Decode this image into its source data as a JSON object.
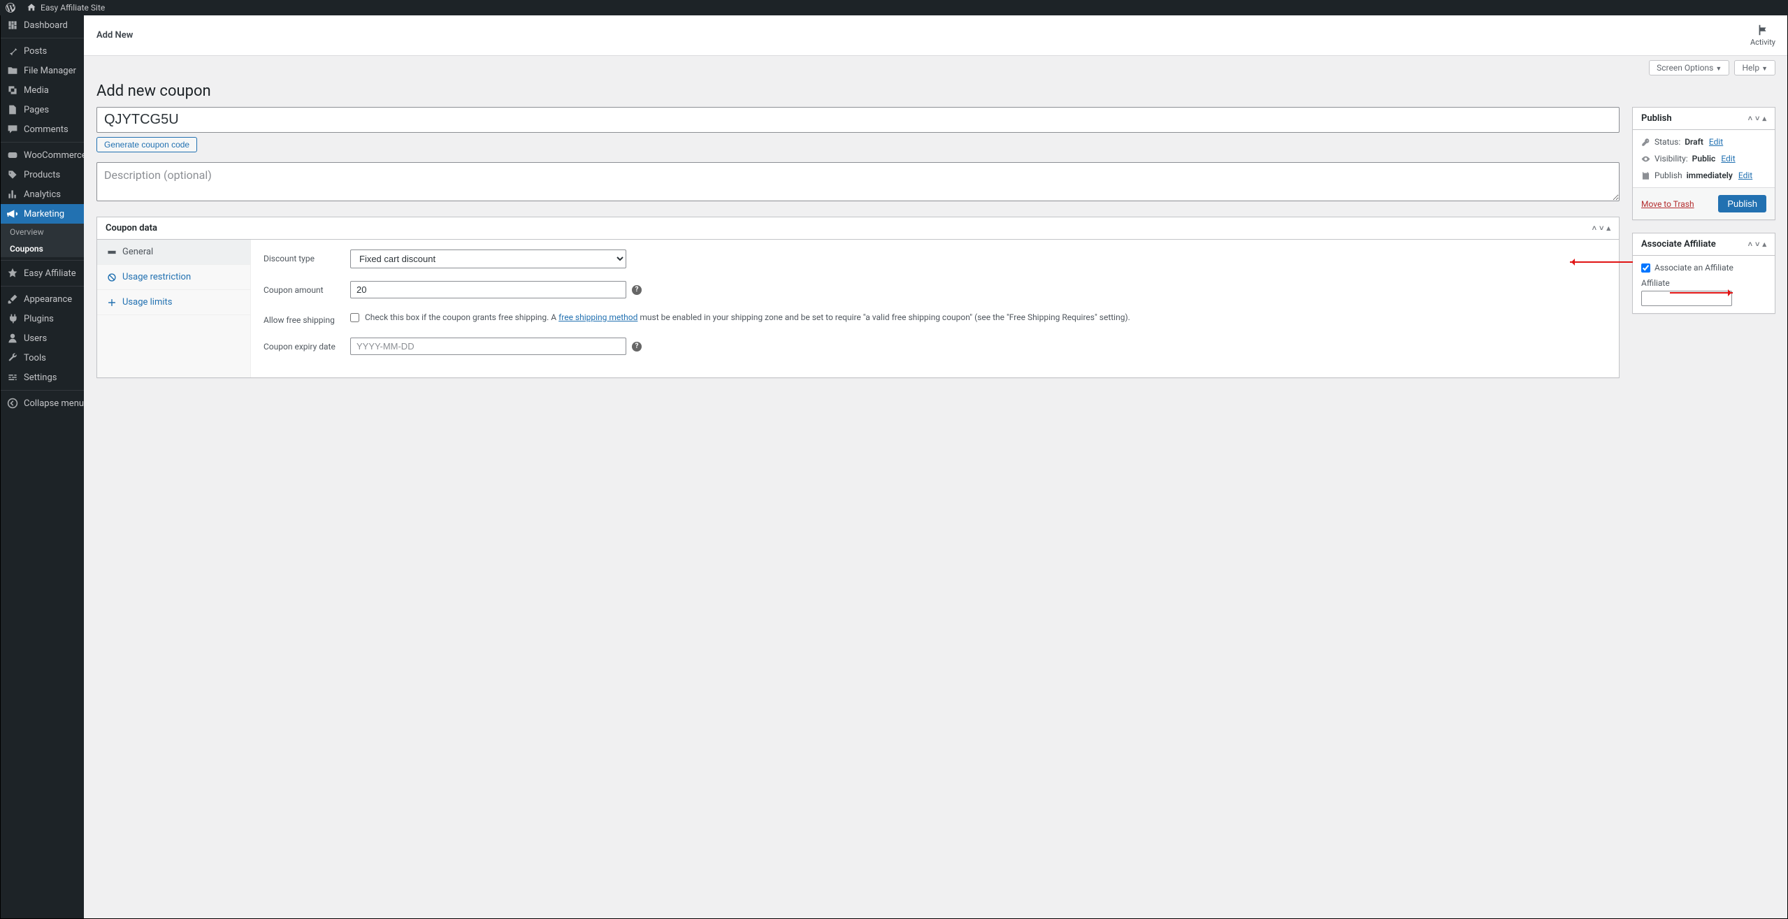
{
  "adminbar": {
    "site_name": "Easy Affiliate Site"
  },
  "sidebar": {
    "items": [
      {
        "label": "Dashboard"
      },
      {
        "label": "Posts"
      },
      {
        "label": "File Manager"
      },
      {
        "label": "Media"
      },
      {
        "label": "Pages"
      },
      {
        "label": "Comments"
      },
      {
        "label": "WooCommerce"
      },
      {
        "label": "Products"
      },
      {
        "label": "Analytics"
      },
      {
        "label": "Marketing"
      },
      {
        "label": "Easy Affiliate"
      },
      {
        "label": "Appearance"
      },
      {
        "label": "Plugins"
      },
      {
        "label": "Users"
      },
      {
        "label": "Tools"
      },
      {
        "label": "Settings"
      },
      {
        "label": "Collapse menu"
      }
    ],
    "submenu": {
      "overview": "Overview",
      "coupons": "Coupons"
    }
  },
  "subheader": {
    "title": "Add New",
    "activity": "Activity"
  },
  "screenlinks": {
    "screen_options": "Screen Options",
    "help": "Help"
  },
  "page": {
    "heading": "Add new coupon",
    "coupon_code": "QJYTCG5U",
    "generate_btn": "Generate coupon code",
    "desc_placeholder": "Description (optional)"
  },
  "coupon_data": {
    "title": "Coupon data",
    "tabs": {
      "general": "General",
      "usage_restriction": "Usage restriction",
      "usage_limits": "Usage limits"
    },
    "fields": {
      "discount_type_label": "Discount type",
      "discount_type_value": "Fixed cart discount",
      "coupon_amount_label": "Coupon amount",
      "coupon_amount_value": "20",
      "free_shipping_label": "Allow free shipping",
      "free_shipping_text_pre": "Check this box if the coupon grants free shipping. A ",
      "free_shipping_link": "free shipping method",
      "free_shipping_text_post": " must be enabled in your shipping zone and be set to require \"a valid free shipping coupon\" (see the \"Free Shipping Requires\" setting).",
      "expiry_label": "Coupon expiry date",
      "expiry_placeholder": "YYYY-MM-DD"
    }
  },
  "publish": {
    "title": "Publish",
    "status_label": "Status:",
    "status_value": "Draft",
    "visibility_label": "Visibility:",
    "visibility_value": "Public",
    "schedule_label": "Publish",
    "schedule_value": "immediately",
    "edit": "Edit",
    "trash": "Move to Trash",
    "submit": "Publish"
  },
  "affiliate_box": {
    "title": "Associate Affiliate",
    "checkbox_label": "Associate an Affiliate",
    "field_label": "Affiliate"
  }
}
